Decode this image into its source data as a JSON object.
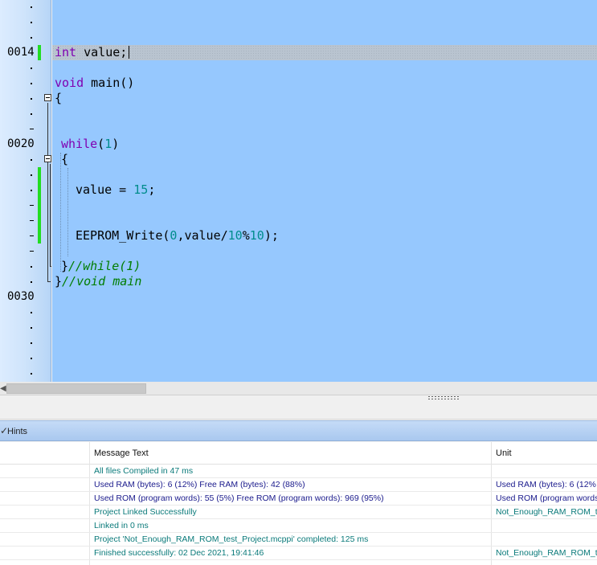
{
  "editor": {
    "line_numbers": [
      {
        "row": 3,
        "label": "0014"
      },
      {
        "row": 9,
        "label": "0020"
      },
      {
        "row": 19,
        "label": "0030"
      }
    ],
    "code": {
      "l1_type": "int",
      "l1_rest": " value;",
      "l3_type": "void",
      "l3_rest": " main()",
      "l4": "{",
      "l7_kw": "while",
      "l7_open": "(",
      "l7_num": "1",
      "l7_close": ")",
      "l8": "{",
      "l10_rest": "value = ",
      "l10_num": "15",
      "l10_end": ";",
      "l13_a": "EEPROM_Write(",
      "l13_n1": "0",
      "l13_b": ",value/",
      "l13_n2": "10",
      "l13_c": "%",
      "l13_n3": "10",
      "l13_d": ");",
      "l15_brace": "}",
      "l15_cmt": "//while(1)",
      "l16_brace": "}",
      "l16_cmt": "//void main"
    }
  },
  "panel": {
    "tab_label": "Hints",
    "columns": {
      "message": "Message Text",
      "unit": "Unit"
    },
    "messages": [
      {
        "text": "All files Compiled in 47 ms",
        "unit": "",
        "color": "#0a7a7a"
      },
      {
        "text": "Used RAM (bytes): 6 (12%)  Free RAM (bytes): 42 (88%)",
        "unit": "Used RAM (bytes): 6 (12%",
        "color": "#1a1a8c"
      },
      {
        "text": "Used ROM (program words): 55 (5%)  Free ROM (program words): 969 (95%)",
        "unit": "Used ROM (program words",
        "color": "#1a1a8c"
      },
      {
        "text": "Project Linked Successfully",
        "unit": "Not_Enough_RAM_ROM_t",
        "color": "#0a7a7a"
      },
      {
        "text": "Linked in 0 ms",
        "unit": "",
        "color": "#0a7a7a"
      },
      {
        "text": "Project 'Not_Enough_RAM_ROM_test_Project.mcppi' completed: 125 ms",
        "unit": "",
        "color": "#0a7a7a"
      },
      {
        "text": "Finished successfully: 02 Dec 2021, 19:41:46",
        "unit": "Not_Enough_RAM_ROM_t",
        "color": "#0a7a7a"
      }
    ]
  },
  "colors": {
    "editor_bg": "#96c8fe",
    "keyword": "#7f00b2",
    "number": "#008c8c",
    "comment": "#007d00",
    "change_marker": "#22dd22"
  }
}
